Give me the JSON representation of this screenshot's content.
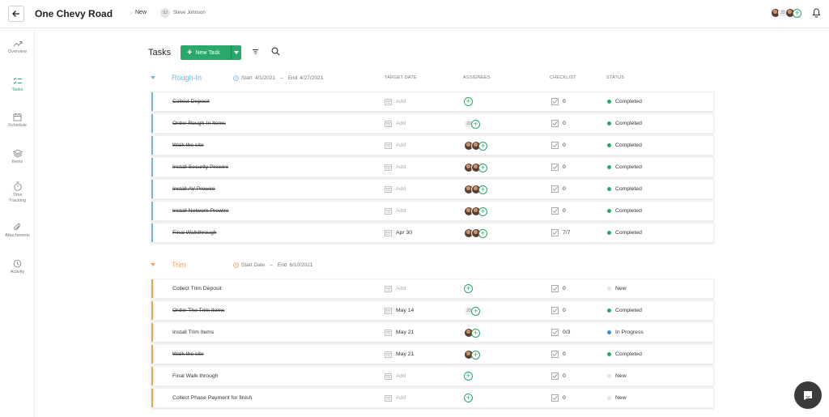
{
  "project": {
    "title": "One Chevy Road",
    "status": "New",
    "owner_initials": "SJ",
    "owner_name": "Steve Johnson",
    "team_initials": "JD"
  },
  "sidebar": {
    "items": [
      {
        "label": "Overview",
        "icon": "trend-icon"
      },
      {
        "label": "Tasks",
        "icon": "tasks-icon"
      },
      {
        "label": "Schedule",
        "icon": "calendar-icon"
      },
      {
        "label": "Items",
        "icon": "stack-icon"
      },
      {
        "label": "Time Tracking",
        "icon": "stopwatch-icon"
      },
      {
        "label": "Attachments",
        "icon": "paperclip-icon"
      },
      {
        "label": "Activity",
        "icon": "clock-icon"
      }
    ]
  },
  "toolbar": {
    "heading": "Tasks",
    "new_task_label": "New Task"
  },
  "columns": {
    "target_date": "TARGET DATE",
    "assignees": "ASSIGNEES",
    "checklist": "CHECKLIST",
    "status": "STATUS"
  },
  "colors": {
    "accent": "#2aa86b",
    "rough_in": "#6fb8e0",
    "trim": "#f5a14a",
    "completed": "#2aa86b",
    "in_progress": "#3b8fd6",
    "new": "#e4e4e4"
  },
  "groups": [
    {
      "name": "Rough-In",
      "start_label": "Start",
      "start": "4/1/2021",
      "end_label": "End",
      "end": "4/27/2021",
      "tasks": [
        {
          "name": "Collect Deposit",
          "date": "Add",
          "assignees": "add",
          "checklist": "0",
          "status": "Completed"
        },
        {
          "name": "Order Rough-In Items",
          "date": "Add",
          "assignees": "JD",
          "checklist": "0",
          "status": "Completed"
        },
        {
          "name": "Walk the site",
          "date": "Add",
          "assignees": "photos",
          "checklist": "0",
          "status": "Completed"
        },
        {
          "name": "Install Security Prewire",
          "date": "Add",
          "assignees": "photos",
          "checklist": "0",
          "status": "Completed"
        },
        {
          "name": "Install AV Prewire",
          "date": "Add",
          "assignees": "photos",
          "checklist": "0",
          "status": "Completed"
        },
        {
          "name": "Install Network Prewire",
          "date": "Add",
          "assignees": "photos",
          "checklist": "0",
          "status": "Completed"
        },
        {
          "name": "Final Walkthrough",
          "date": "Apr 30",
          "assignees": "photos",
          "checklist": "7/7",
          "status": "Completed"
        }
      ]
    },
    {
      "name": "Trim",
      "start_label": "Start Date",
      "start": "",
      "end_label": "End",
      "end": "6/10/2021",
      "tasks": [
        {
          "name": "Collect Trim Deposit",
          "date": "Add",
          "assignees": "add",
          "checklist": "0",
          "status": "New"
        },
        {
          "name": "Order The Trim Items",
          "date": "May 14",
          "assignees": "JD",
          "checklist": "0",
          "status": "Completed"
        },
        {
          "name": "Install Trim Items",
          "date": "May 21",
          "assignees": "photo",
          "checklist": "0/3",
          "status": "In Progress"
        },
        {
          "name": "Walk the site",
          "date": "May 21",
          "assignees": "photo",
          "checklist": "0",
          "status": "Completed"
        },
        {
          "name": "Final Walk through",
          "date": "Add",
          "assignees": "add",
          "checklist": "0",
          "status": "New"
        },
        {
          "name": "Collect Phase Payment for finish",
          "date": "Add",
          "assignees": "add",
          "checklist": "0",
          "status": "New"
        }
      ]
    }
  ]
}
